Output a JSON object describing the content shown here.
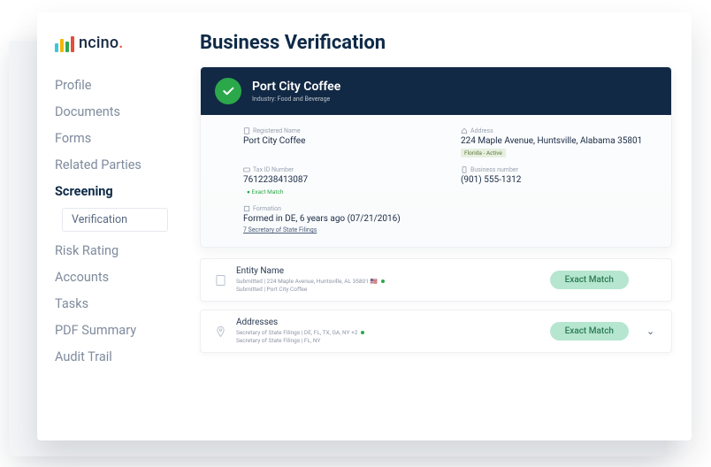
{
  "logo_text": "ncino",
  "page_title": "Business Verification",
  "nav": {
    "items": [
      {
        "label": "Profile"
      },
      {
        "label": "Documents"
      },
      {
        "label": "Forms"
      },
      {
        "label": "Related Parties"
      },
      {
        "label": "Screening",
        "active": true,
        "sub": "Verification"
      },
      {
        "label": "Risk Rating"
      },
      {
        "label": "Accounts"
      },
      {
        "label": "Tasks"
      },
      {
        "label": "PDF Summary"
      },
      {
        "label": "Audit Trail"
      }
    ]
  },
  "header": {
    "name": "Port City Coffee",
    "industry": "Industry: Food and Beverage"
  },
  "fields": {
    "registered_name": {
      "label": "Registered Name",
      "value": "Port City Coffee"
    },
    "address": {
      "label": "Address",
      "value": "224 Maple Avenue, Huntsville, Alabama 35801",
      "tag": "Florida - Active"
    },
    "taxid": {
      "label": "Tax ID Number",
      "value": "7612238413087",
      "match": "Exact Match"
    },
    "biznum": {
      "label": "Business number",
      "value": "(901) 555-1312"
    },
    "formation": {
      "label": "Formation",
      "value": "Formed in DE, 6 years ago (07/21/2016)",
      "link": "7 Secretary of State Filings"
    }
  },
  "results": [
    {
      "title": "Entity Name",
      "line1": "Submitted | 224 Maple Avenue, Huntsville, AL 35801 🇺🇸",
      "line2": "Submitted | Port City Coffee",
      "badge": "Exact Match",
      "expandable": false
    },
    {
      "title": "Addresses",
      "line1": "Secretary of State Filings | DE, FL, TX, GA, NY +2",
      "line2": "Secretary of State Filings | FL, NY",
      "badge": "Exact Match",
      "expandable": true
    }
  ]
}
